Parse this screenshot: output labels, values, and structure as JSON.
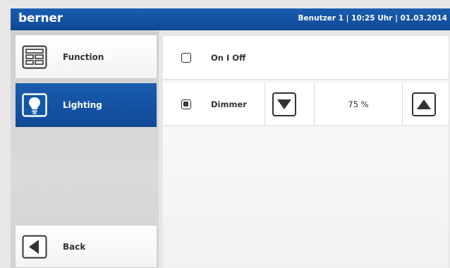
{
  "header": {
    "brand": "berner",
    "status": "Benutzer 1 | 10:25 Uhr | 01.03.2014"
  },
  "sidebar": {
    "items": [
      {
        "label": "Function",
        "icon": "function-grid-icon",
        "active": false
      },
      {
        "label": "Lighting",
        "icon": "light-bulb-icon",
        "active": true
      }
    ],
    "back_label": "Back"
  },
  "main": {
    "rows": [
      {
        "label": "On I Off",
        "checked": false
      },
      {
        "label": "Dimmer",
        "checked": true,
        "value": "75 %",
        "decrease_icon": "arrow-down-icon",
        "increase_icon": "arrow-up-icon"
      }
    ]
  },
  "colors": {
    "accent": "#1257a8",
    "background": "#e7e7e7",
    "panel": "#ffffff"
  }
}
